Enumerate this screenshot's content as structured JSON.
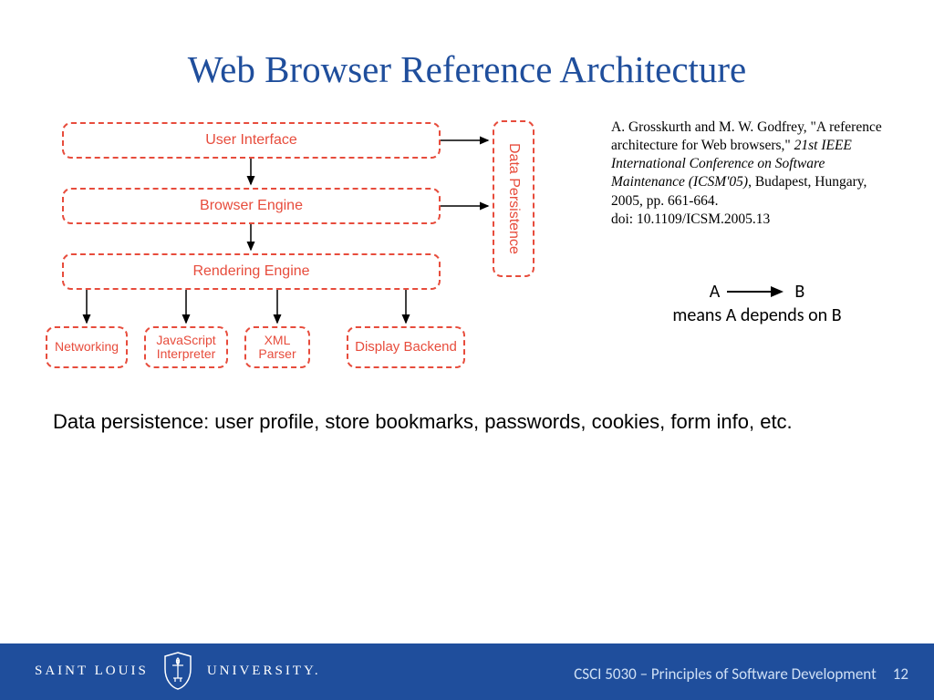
{
  "title": "Web Browser Reference Architecture",
  "diagram": {
    "boxes": {
      "ui": "User Interface",
      "browser_engine": "Browser Engine",
      "rendering_engine": "Rendering Engine",
      "networking": "Networking",
      "js": "JavaScript Interpreter",
      "xml": "XML Parser",
      "display_backend": "Display Backend",
      "data_persistence": "Data Persistence"
    }
  },
  "citation": {
    "authors_title_prefix": "A. Grosskurth and M. W. Godfrey, \"A reference architecture for Web browsers,\" ",
    "venue": "21st IEEE International Conference on Software Maintenance (ICSM'05)",
    "rest": ", Budapest, Hungary, 2005, pp. 661-664.",
    "doi": "doi: 10.1109/ICSM.2005.13"
  },
  "legend": {
    "a": "A",
    "b": "B",
    "text": "means A depends on B"
  },
  "data_persist_text": "Data persistence: user profile, store bookmarks, passwords, cookies, form info, etc.",
  "footer": {
    "logo_left": "SAINT LOUIS",
    "logo_right": "UNIVERSITY.",
    "course": "CSCI 5030 – Principles of Software Development",
    "page": "12"
  }
}
